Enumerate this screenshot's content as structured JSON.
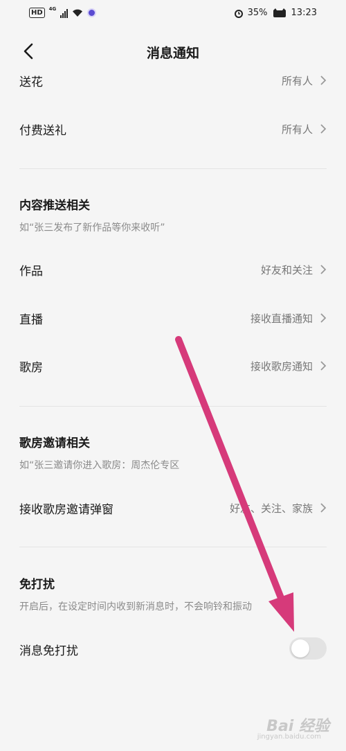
{
  "status_bar": {
    "hd": "HD",
    "network": "4G",
    "battery": "35%",
    "time": "13:23"
  },
  "header": {
    "title": "消息通知"
  },
  "rows": {
    "flowers": {
      "label": "送花",
      "value": "所有人"
    },
    "paid_gift": {
      "label": "付费送礼",
      "value": "所有人"
    },
    "works": {
      "label": "作品",
      "value": "好友和关注"
    },
    "live": {
      "label": "直播",
      "value": "接收直播通知"
    },
    "song_room": {
      "label": "歌房",
      "value": "接收歌房通知"
    },
    "room_invite_popup": {
      "label": "接收歌房邀请弹窗",
      "value": "好友、关注、家族"
    },
    "dnd": {
      "label": "消息免打扰",
      "enabled": false
    }
  },
  "sections": {
    "content_push": {
      "title": "内容推送相关",
      "desc": "如“张三发布了新作品等你来收听”"
    },
    "room_invite": {
      "title": "歌房邀请相关",
      "desc": "如“张三邀请你进入歌房：周杰伦专区"
    },
    "dnd": {
      "title": "免打扰",
      "desc": "开启后，在设定时间内收到新消息时，不会响铃和振动"
    }
  },
  "watermark": {
    "text": "Bai 经验",
    "sub": "jingyan.baidu.com"
  },
  "colors": {
    "annotation_arrow": "#d63a7a",
    "toggle_off": "#e3e3e3",
    "background": "#f5f5f5"
  }
}
